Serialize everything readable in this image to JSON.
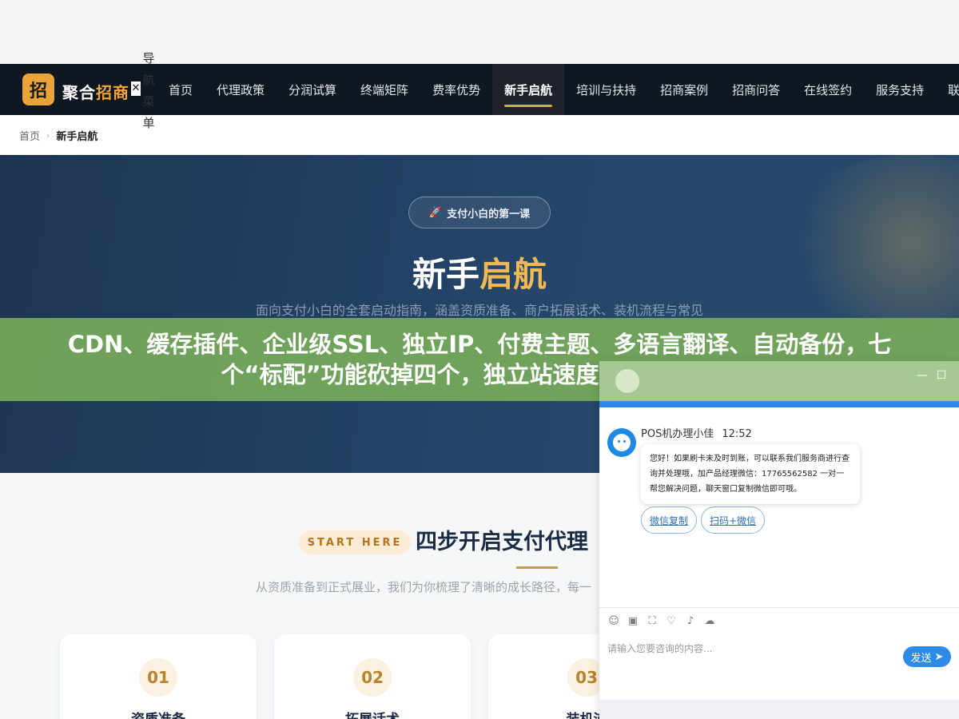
{
  "nav_toggle_label": "导航菜单",
  "close_symbol": "✕",
  "header": {
    "logo_char": "招",
    "brand_main": "聚合",
    "brand_accent": "招商",
    "nav": [
      {
        "label": "首页",
        "active": false
      },
      {
        "label": "代理政策",
        "active": false
      },
      {
        "label": "分润试算",
        "active": false
      },
      {
        "label": "终端矩阵",
        "active": false
      },
      {
        "label": "费率优势",
        "active": false
      },
      {
        "label": "新手启航",
        "active": true
      },
      {
        "label": "培训与扶持",
        "active": false
      },
      {
        "label": "招商案例",
        "active": false
      },
      {
        "label": "招商问答",
        "active": false
      },
      {
        "label": "在线签约",
        "active": false
      },
      {
        "label": "服务支持",
        "active": false
      },
      {
        "label": "联系",
        "active": false
      }
    ],
    "colors": {
      "bar": "#0f1720",
      "accent": "#e8a33a"
    }
  },
  "breadcrumb": {
    "home": "首页",
    "separator": "›",
    "current": "新手启航"
  },
  "hero": {
    "pill_icon": "rocket-icon",
    "pill_text": "支付小白的第一课",
    "title_main": "新手",
    "title_accent": "启航",
    "subtitle": "面向支付小白的全套启动指南，涵盖资质准备、商户拓展话术、装机流程与常见"
  },
  "banner": {
    "text": "CDN、缓存插件、企业级SSL、独立IP、付费主题、多语言翻译、自动备份，七个“标配”功能砍掉四个，独立站速度反而快了一倍"
  },
  "main": {
    "start_pill": "START HERE",
    "section_title": "四步开启支付代理",
    "section_sub": "从资质准备到正式展业，我们为你梳理了清晰的成长路径，每一",
    "cards": [
      {
        "num": "01",
        "title": "资质准备"
      },
      {
        "num": "02",
        "title": "拓展话术"
      },
      {
        "num": "03",
        "title": "装机流"
      }
    ]
  },
  "chat": {
    "agent_name": "POS机办理小佳",
    "time": "12:52",
    "message": "您好！如果刷卡未及时到账，可以联系我们服务商进行查询并处理哦，加产品经理微信：17765562582 一对一帮您解决问题，聊天窗口复制微信即可哦。",
    "quick_buttons": [
      "微信复制",
      "扫码+微信"
    ],
    "tools": [
      "emoji-icon",
      "image-icon",
      "screenshot-icon",
      "rating-icon",
      "voice-icon",
      "wechat-icon"
    ],
    "input_placeholder": "请输入您要咨询的内容...",
    "send_label": "发送",
    "colors": {
      "primary": "#2b8be6"
    }
  }
}
